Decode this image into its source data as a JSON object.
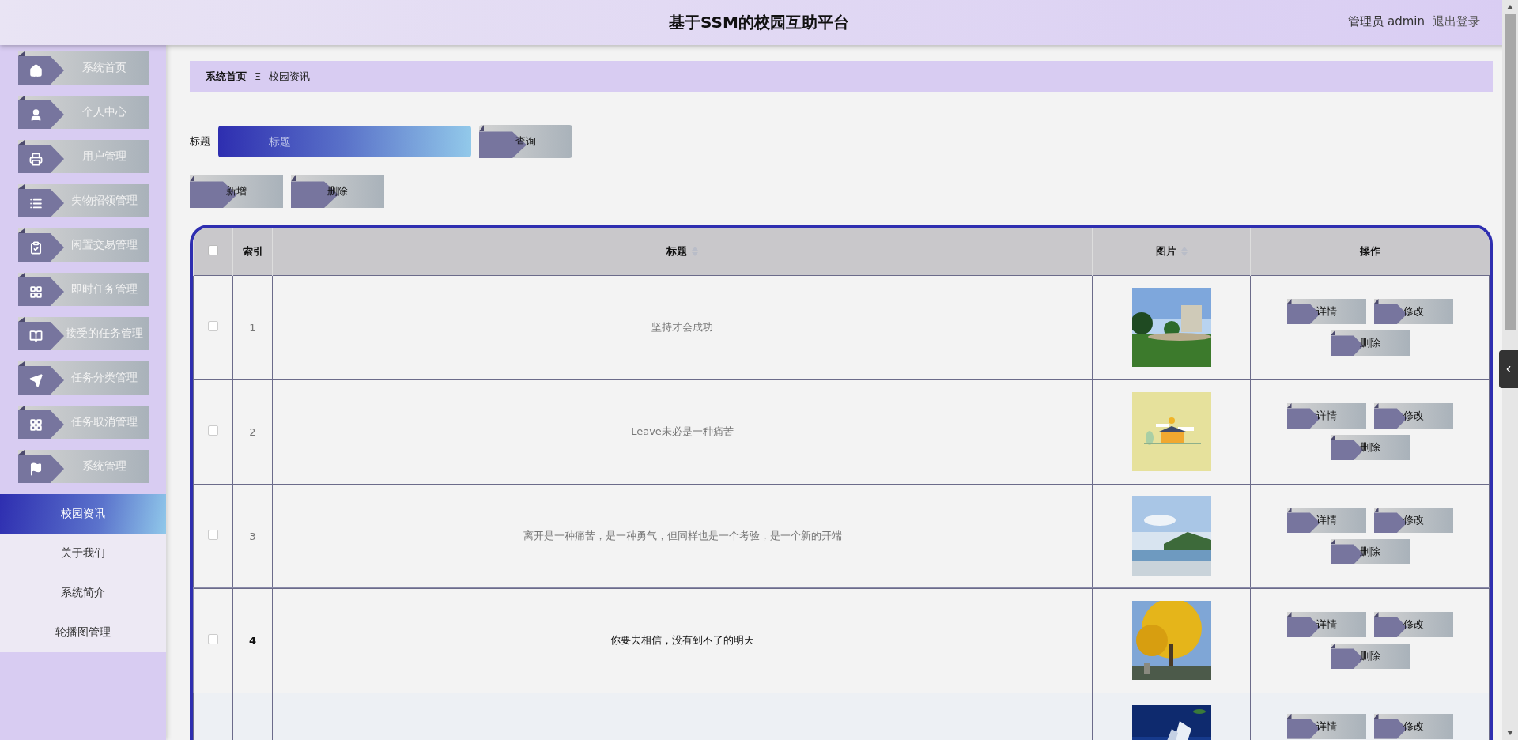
{
  "header": {
    "title": "基于SSM的校园互助平台",
    "user": "管理员 admin",
    "logout": "退出登录"
  },
  "sidebar": {
    "items": [
      {
        "label": "系统首页"
      },
      {
        "label": "个人中心"
      },
      {
        "label": "用户管理"
      },
      {
        "label": "失物招领管理"
      },
      {
        "label": "闲置交易管理"
      },
      {
        "label": "即时任务管理"
      },
      {
        "label": "接受的任务管理"
      },
      {
        "label": "任务分类管理"
      },
      {
        "label": "任务取消管理"
      },
      {
        "label": "系统管理"
      }
    ],
    "submenu": [
      {
        "label": "校园资讯",
        "selected": true
      },
      {
        "label": "关于我们",
        "selected": false
      },
      {
        "label": "系统简介",
        "selected": false
      },
      {
        "label": "轮播图管理",
        "selected": false
      }
    ]
  },
  "breadcrumb": {
    "home": "系统首页",
    "separator": "Ξ",
    "current": "校园资讯"
  },
  "search": {
    "label": "标题",
    "placeholder": "标题",
    "button": "查询"
  },
  "actions": [
    "新增",
    "删除"
  ],
  "table": {
    "select_all_checked": false,
    "columns": [
      {
        "label": "索引",
        "sortable": false
      },
      {
        "label": "标题",
        "sortable": true
      },
      {
        "label": "图片",
        "sortable": true
      },
      {
        "label": "操作",
        "sortable": false
      }
    ],
    "rows": [
      {
        "index": "1",
        "title": "坚持才会成功",
        "hovered": false,
        "checked": false,
        "buttons": [
          "详情",
          "修改",
          "删除"
        ]
      },
      {
        "index": "2",
        "title": "Leave未必是一种痛苦",
        "hovered": false,
        "checked": false,
        "buttons": [
          "详情",
          "修改",
          "删除"
        ]
      },
      {
        "index": "3",
        "title": "离开是一种痛苦，是一种勇气，但同样也是一个考验，是一个新的开端",
        "hovered": false,
        "checked": false,
        "buttons": [
          "详情",
          "修改",
          "删除"
        ]
      },
      {
        "index": "4",
        "title": "你要去相信，没有到不了的明天",
        "hovered": true,
        "checked": false,
        "buttons": [
          "详情",
          "修改",
          "删除"
        ]
      },
      {
        "hovered": false,
        "buttons": [
          "详情",
          "修改"
        ]
      }
    ]
  }
}
